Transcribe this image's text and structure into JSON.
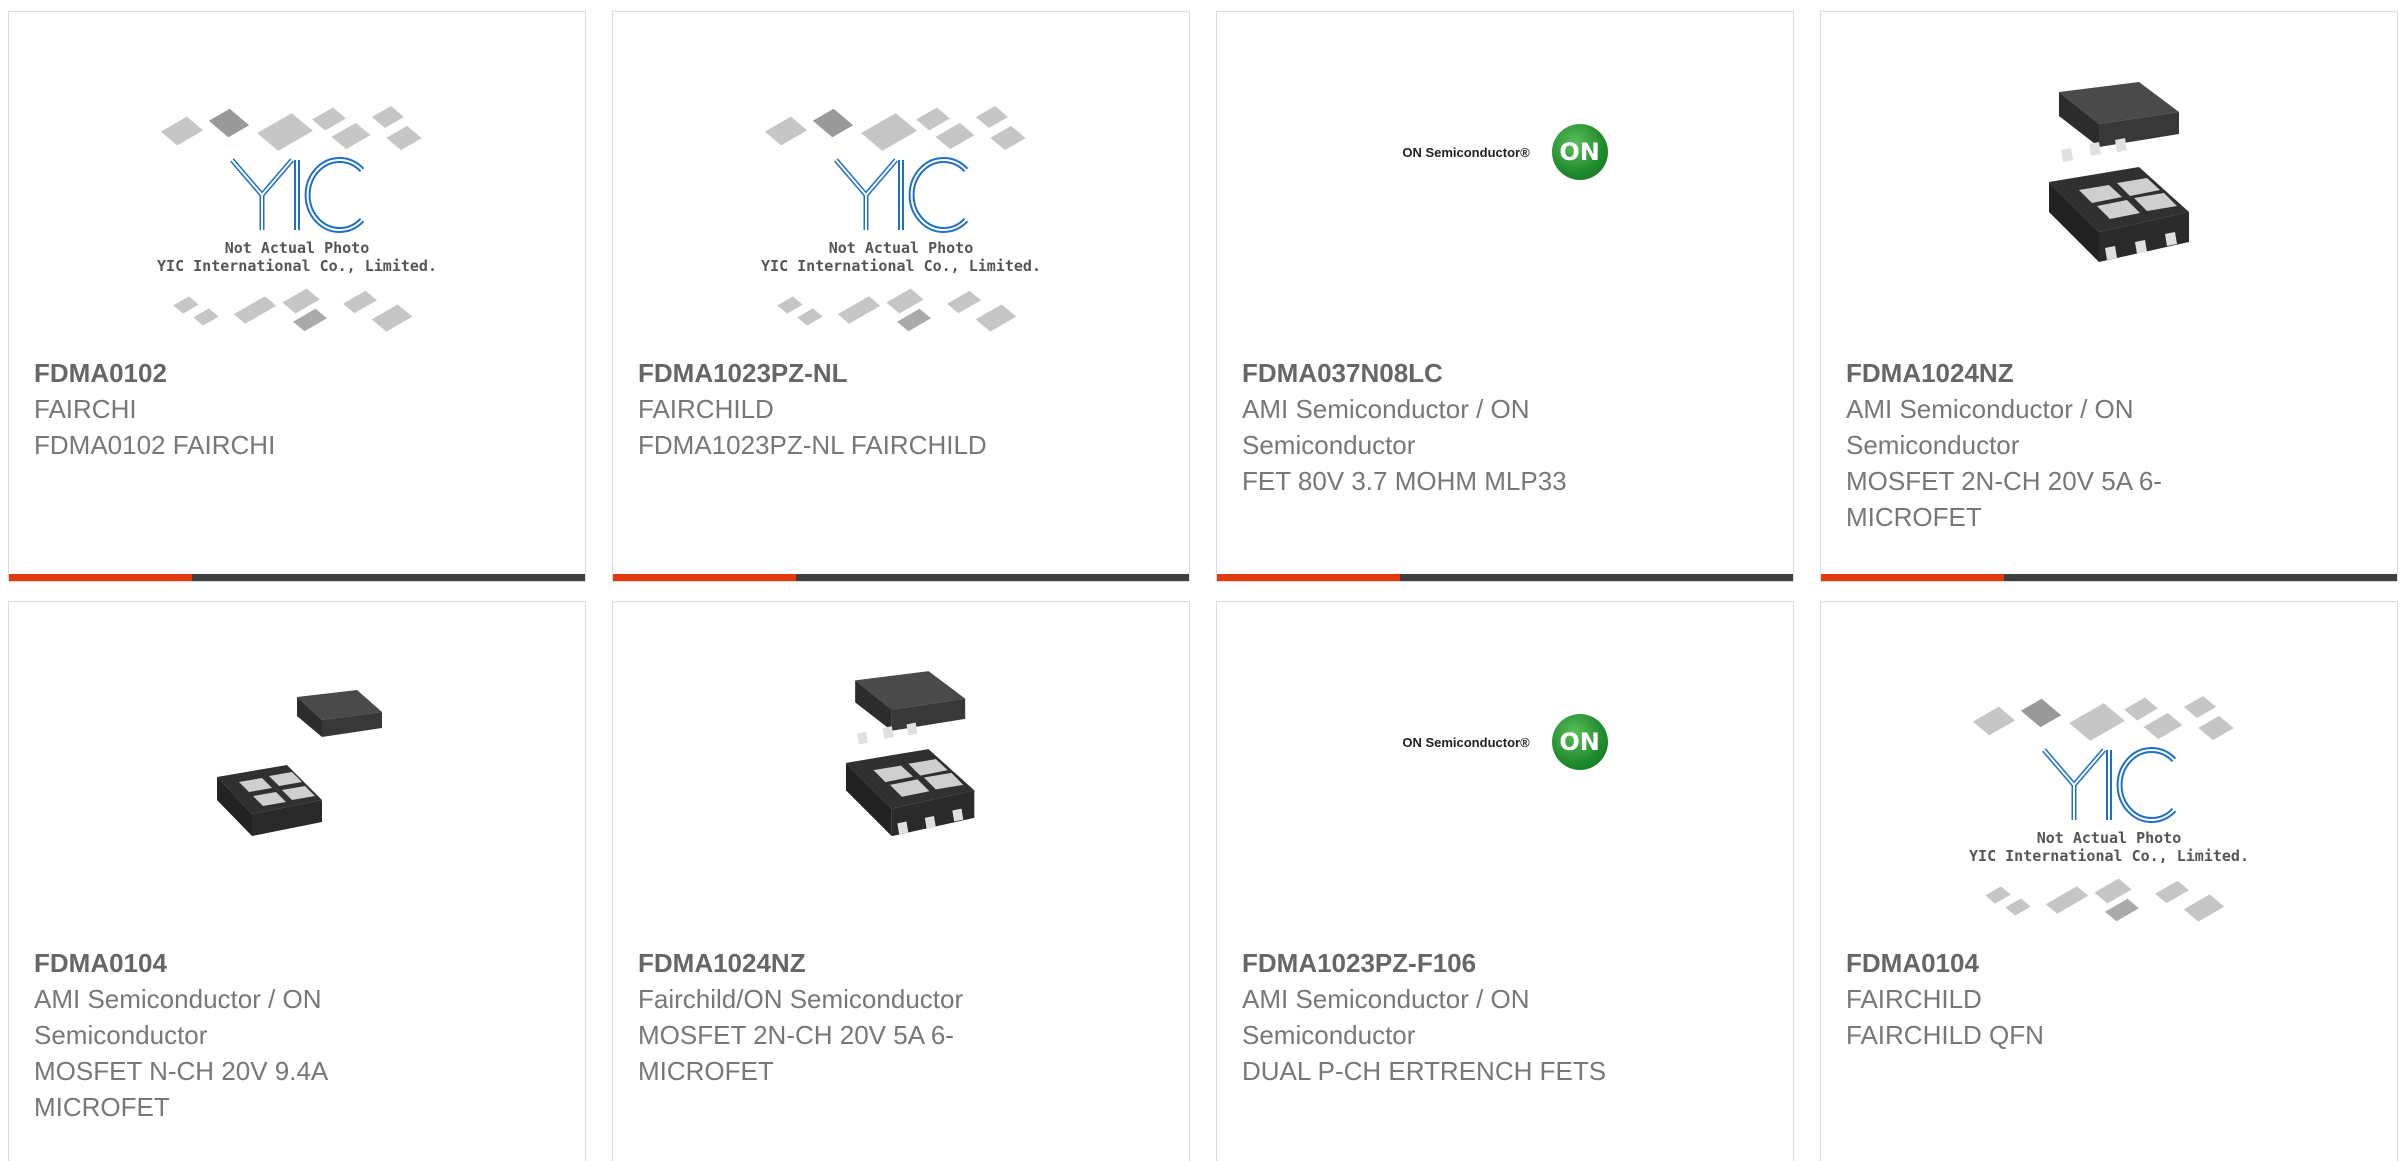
{
  "products": [
    {
      "part": "FDMA0102",
      "manufacturer": "FAIRCHI",
      "description": "FDMA0102 FAIRCHI",
      "image": "not-actual-photo"
    },
    {
      "part": "FDMA1023PZ-NL",
      "manufacturer": "FAIRCHILD",
      "description": "FDMA1023PZ-NL FAIRCHILD",
      "image": "not-actual-photo"
    },
    {
      "part": "FDMA037N08LC",
      "manufacturer": "AMI Semiconductor / ON Semiconductor",
      "description": "FET 80V 3.7 MOHM MLP33",
      "image": "on-semiconductor-logo"
    },
    {
      "part": "FDMA1024NZ",
      "manufacturer": "AMI Semiconductor / ON Semiconductor",
      "description": "MOSFET 2N-CH 20V 5A 6-MICROFET",
      "image": "microfet-package"
    },
    {
      "part": "FDMA0104",
      "manufacturer": "AMI Semiconductor / ON Semiconductor",
      "description": "MOSFET N-CH 20V 9.4A MICROFET",
      "image": "microfet-package-small"
    },
    {
      "part": "FDMA1024NZ",
      "manufacturer": "Fairchild/ON Semiconductor",
      "description": "MOSFET 2N-CH 20V 5A 6-MICROFET",
      "image": "microfet-package"
    },
    {
      "part": "FDMA1023PZ-F106",
      "manufacturer": "AMI Semiconductor / ON Semiconductor",
      "description": "DUAL P-CH ERTRENCH FETS",
      "image": "on-semiconductor-logo"
    },
    {
      "part": "FDMA0104",
      "manufacturer": "FAIRCHILD",
      "description": "FAIRCHILD QFN",
      "image": "not-actual-photo"
    }
  ],
  "placeholder": {
    "line1": "Not Actual Photo",
    "line2": "YIC International Co., Limited."
  },
  "on_logo": {
    "name": "ON Semiconductor®",
    "mark": "ON"
  },
  "colors": {
    "accent": "#e23a0e",
    "bar": "#3f3f3f",
    "border": "#dcdcdc",
    "text": "#777777"
  }
}
